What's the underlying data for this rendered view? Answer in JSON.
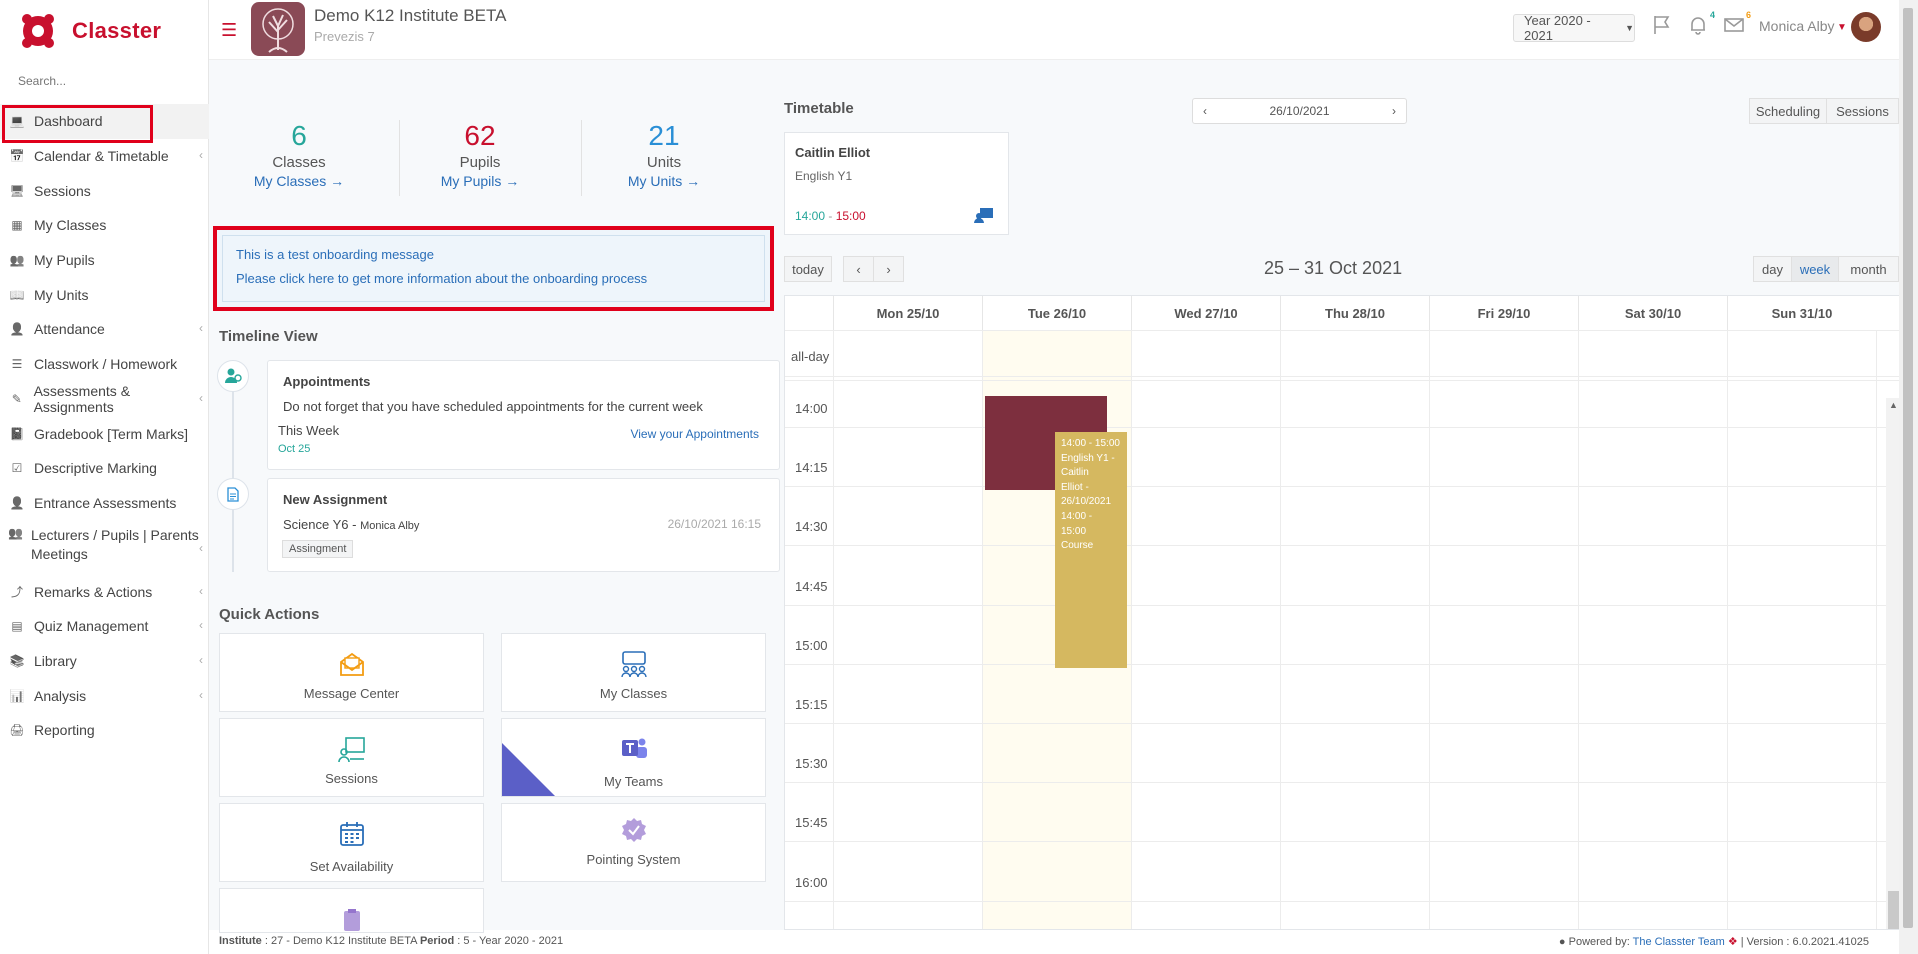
{
  "brand": {
    "name": "Classter"
  },
  "sidebar": {
    "search_placeholder": "Search...",
    "items": [
      {
        "label": "Dashboard",
        "icon": "laptop-icon",
        "active": true
      },
      {
        "label": "Calendar & Timetable",
        "icon": "calendar-icon",
        "has_submenu": true
      },
      {
        "label": "Sessions",
        "icon": "sessions-icon"
      },
      {
        "label": "My Classes",
        "icon": "classes-icon"
      },
      {
        "label": "My Pupils",
        "icon": "pupils-icon"
      },
      {
        "label": "My Units",
        "icon": "book-icon"
      },
      {
        "label": "Attendance",
        "icon": "attendance-icon",
        "has_submenu": true
      },
      {
        "label": "Classwork / Homework",
        "icon": "list-icon"
      },
      {
        "label": "Assessments & Assignments",
        "icon": "edit-icon",
        "has_submenu": true
      },
      {
        "label": "Gradebook [Term Marks]",
        "icon": "gradebook-icon"
      },
      {
        "label": "Descriptive Marking",
        "icon": "check-icon"
      },
      {
        "label": "Entrance Assessments",
        "icon": "user-icon"
      },
      {
        "label": "Lecturers / Pupils | Parents Meetings",
        "icon": "meetings-icon",
        "has_submenu": true
      },
      {
        "label": "Remarks & Actions",
        "icon": "remarks-icon",
        "has_submenu": true
      },
      {
        "label": "Quiz Management",
        "icon": "quiz-icon",
        "has_submenu": true
      },
      {
        "label": "Library",
        "icon": "library-icon",
        "has_submenu": true
      },
      {
        "label": "Analysis",
        "icon": "chart-icon",
        "has_submenu": true
      },
      {
        "label": "Reporting",
        "icon": "printer-icon"
      }
    ]
  },
  "header": {
    "institute_name": "Demo K12 Institute BETA",
    "institute_sub": "Prevezis 7",
    "year": "Year 2020 - 2021",
    "notifications_count": "4",
    "messages_count": "6",
    "user_name": "Monica Alby"
  },
  "stats": [
    {
      "number": "6",
      "label": "Classes",
      "link": "My Classes →",
      "color": "#26a69a"
    },
    {
      "number": "62",
      "label": "Pupils",
      "link": "My Pupils →",
      "color": "#c8102e"
    },
    {
      "number": "21",
      "label": "Units",
      "link": "My Units →",
      "color": "#2a8fd6"
    }
  ],
  "onboarding": {
    "line1": "This is a test onboarding message",
    "line2": "Please click here to get more information about the onboarding process"
  },
  "timeline": {
    "title": "Timeline View",
    "appointments": {
      "title": "Appointments",
      "text": "Do not forget that you have scheduled appointments for the current week",
      "when": "This Week",
      "date": "Oct 25",
      "link": "View your Appointments"
    },
    "assignment": {
      "title": "New Assignment",
      "subject": "Science Y6 -",
      "author": "Monica Alby",
      "datetime": "26/10/2021 16:15",
      "tag": "Assingment"
    }
  },
  "quick_actions": {
    "title": "Quick Actions",
    "items": [
      {
        "label": "Message Center",
        "icon": "envelope-icon"
      },
      {
        "label": "My Classes",
        "icon": "classes-icon"
      },
      {
        "label": "Sessions",
        "icon": "sessions-icon"
      },
      {
        "label": "My Teams",
        "icon": "teams-icon"
      },
      {
        "label": "Set Availability",
        "icon": "calendar-icon"
      },
      {
        "label": "Pointing System",
        "icon": "badge-icon"
      }
    ]
  },
  "timetable": {
    "title": "Timetable",
    "date": "26/10/2021",
    "scheduling_label": "Scheduling",
    "sessions_label": "Sessions",
    "card": {
      "name": "Caitlin Elliot",
      "course": "English Y1",
      "start": "14:00",
      "sep": " - ",
      "end": "15:00"
    },
    "today_label": "today",
    "range": "25 – 31 Oct 2021",
    "views": [
      "day",
      "week",
      "month"
    ],
    "allday_label": "all-day",
    "days": [
      "Mon 25/10",
      "Tue 26/10",
      "Wed 27/10",
      "Thu 28/10",
      "Fri 29/10",
      "Sat 30/10",
      "Sun 31/10"
    ],
    "times": [
      "14:00",
      "14:15",
      "14:30",
      "14:45",
      "15:00",
      "15:15",
      "15:30",
      "15:45",
      "16:00"
    ],
    "event_lines": [
      "14:00 - 15:00",
      "English Y1 -",
      "Caitlin",
      "Elliot -",
      "26/10/2021",
      "14:00 -",
      "15:00",
      "Course"
    ]
  },
  "footer": {
    "institute_label": "Institute",
    "institute_value": ": 27 - Demo K12 Institute BETA",
    "period_label": "Period",
    "period_value": ": 5 - Year 2020 - 2021",
    "powered": "Powered by:",
    "team": "The Classter Team",
    "version": "| Version : 6.0.2021.41025"
  },
  "colors": {
    "accent": "#c8102e",
    "link": "#2a6eb8",
    "event_dark": "#7d2f3e",
    "event_gold": "#d5b860",
    "teams": "#5b5fc7"
  }
}
